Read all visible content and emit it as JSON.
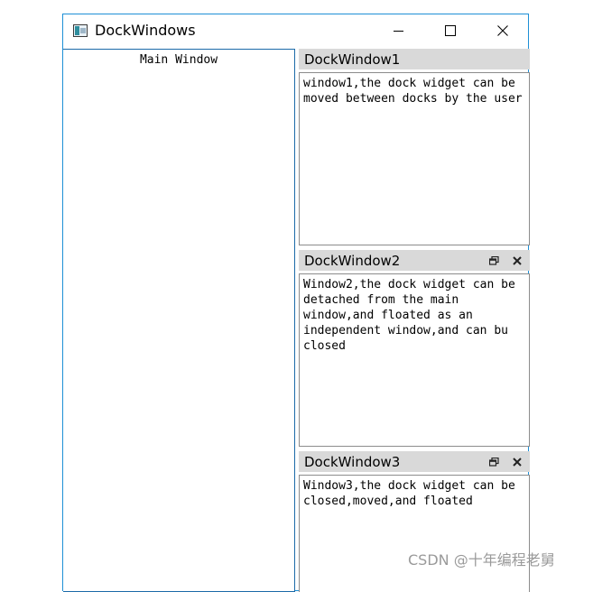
{
  "window": {
    "title": "DockWindows",
    "icon": "app-window-icon",
    "controls": [
      "minimize-icon",
      "maximize-icon",
      "close-icon"
    ]
  },
  "main": {
    "label": "Main Window"
  },
  "docks": [
    {
      "title": "DockWindow1",
      "text": "window1,the dock widget can be moved between docks by the user",
      "buttons": []
    },
    {
      "title": "DockWindow2",
      "text": "Window2,the dock widget can be detached from the main window,and floated as an independent window,and can bu closed",
      "buttons": [
        "float-icon",
        "close-icon"
      ]
    },
    {
      "title": "DockWindow3",
      "text": "Window3,the dock widget can be closed,moved,and floated",
      "buttons": [
        "float-icon",
        "close-icon"
      ]
    }
  ],
  "watermark": "CSDN @十年编程老舅",
  "colors": {
    "window_border": "#1e8fd6",
    "dock_title_bg": "#d9d9d9",
    "dock_border": "#8c8c8c"
  }
}
